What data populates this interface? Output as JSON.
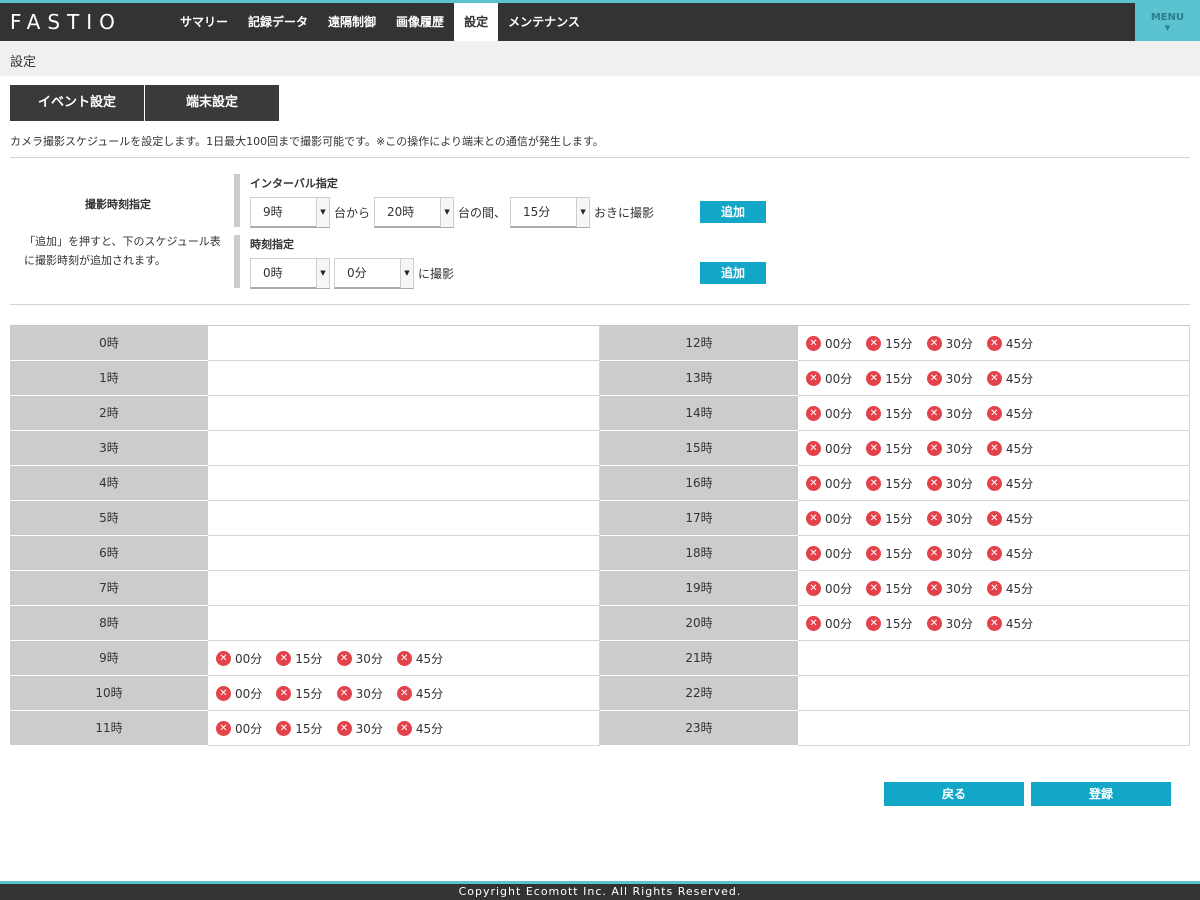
{
  "header": {
    "logo": "FASTIO",
    "nav": [
      "サマリー",
      "記録データ",
      "遠隔制御",
      "画像履歴",
      "設定",
      "メンテナンス"
    ],
    "active_nav": 4,
    "menu_label": "MENU",
    "accent_color": "#5bc2cf"
  },
  "page_title": "設定",
  "tabs": [
    "イベント設定",
    "端末設定"
  ],
  "description": "カメラ撮影スケジュールを設定します。1日最大100回まで撮影可能です。※この操作により端末との通信が発生します。",
  "capture": {
    "section_title": "撮影時刻指定",
    "help_text": "「追加」を押すと、下のスケジュール表に撮影時刻が追加されます。",
    "interval": {
      "title": "インターバル指定",
      "start_value": "9時",
      "from_label": "台から",
      "end_value": "20時",
      "between_label": "台の間、",
      "step_value": "15分",
      "suffix": "おきに撮影",
      "add_label": "追加"
    },
    "time": {
      "title": "時刻指定",
      "hour_value": "0時",
      "minute_value": "0分",
      "suffix": "に撮影",
      "add_label": "追加"
    }
  },
  "schedule": {
    "hour_suffix": "時",
    "left_hours": [
      "0時",
      "1時",
      "2時",
      "3時",
      "4時",
      "5時",
      "6時",
      "7時",
      "8時",
      "9時",
      "10時",
      "11時"
    ],
    "right_hours": [
      "12時",
      "13時",
      "14時",
      "15時",
      "16時",
      "17時",
      "18時",
      "19時",
      "20時",
      "21時",
      "22時",
      "23時"
    ],
    "left_slots": [
      [],
      [],
      [],
      [],
      [],
      [],
      [],
      [],
      [],
      [
        "00分",
        "15分",
        "30分",
        "45分"
      ],
      [
        "00分",
        "15分",
        "30分",
        "45分"
      ],
      [
        "00分",
        "15分",
        "30分",
        "45分"
      ]
    ],
    "right_slots": [
      [
        "00分",
        "15分",
        "30分",
        "45分"
      ],
      [
        "00分",
        "15分",
        "30分",
        "45分"
      ],
      [
        "00分",
        "15分",
        "30分",
        "45分"
      ],
      [
        "00分",
        "15分",
        "30分",
        "45分"
      ],
      [
        "00分",
        "15分",
        "30分",
        "45分"
      ],
      [
        "00分",
        "15分",
        "30分",
        "45分"
      ],
      [
        "00分",
        "15分",
        "30分",
        "45分"
      ],
      [
        "00分",
        "15分",
        "30分",
        "45分"
      ],
      [
        "00分",
        "15分",
        "30分",
        "45分"
      ],
      [],
      [],
      []
    ],
    "remove_icon": "close-circle-icon"
  },
  "actions": {
    "back_label": "戻る",
    "register_label": "登録"
  },
  "footer": "Copyright Ecomott Inc. All Rights Reserved."
}
